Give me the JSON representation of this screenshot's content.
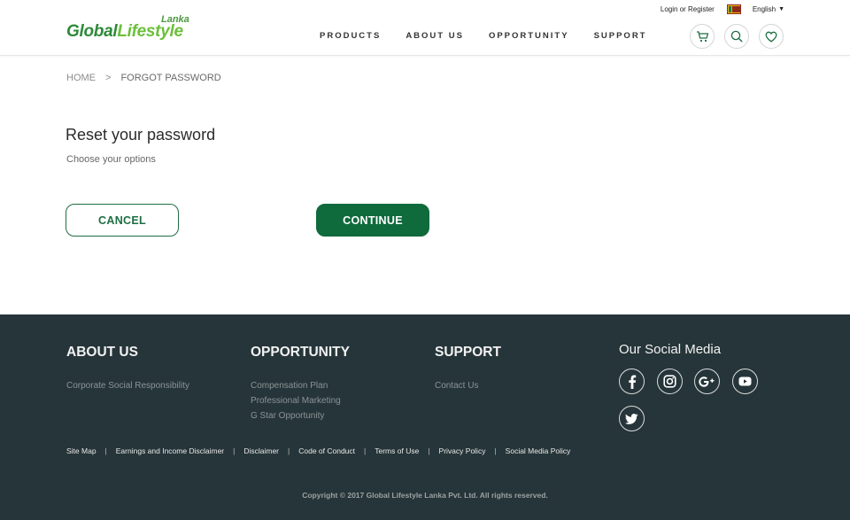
{
  "header": {
    "logo_top": "Lanka",
    "logo_part1": "Global",
    "logo_part2": "Lifestyle",
    "login_register": "Login or Register",
    "language": "English",
    "nav": [
      "PRODUCTS",
      "ABOUT US",
      "OPPORTUNITY",
      "SUPPORT"
    ]
  },
  "breadcrumb": {
    "home": "HOME",
    "separator": ">",
    "current": "FORGOT PASSWORD"
  },
  "main": {
    "title": "Reset your password",
    "subtitle": "Choose your options",
    "cancel_label": "CANCEL",
    "continue_label": "CONTINUE"
  },
  "footer": {
    "about": {
      "heading": "ABOUT US",
      "links": [
        "Corporate Social Responsibility"
      ]
    },
    "opportunity": {
      "heading": "OPPORTUNITY",
      "links": [
        "Compensation Plan",
        "Professional Marketing",
        "G Star Opportunity"
      ]
    },
    "support": {
      "heading": "SUPPORT",
      "links": [
        "Contact Us"
      ]
    },
    "social": {
      "heading": "Our Social Media",
      "icons": [
        "facebook-icon",
        "instagram-icon",
        "google-plus-icon",
        "youtube-icon",
        "twitter-icon"
      ]
    },
    "bottom_links": [
      "Site Map",
      "Earnings and Income Disclaimer",
      "Disclaimer",
      "Code of Conduct",
      "Terms of Use",
      "Privacy Policy",
      "Social Media Policy"
    ],
    "copyright": "Copyright © 2017 Global Lifestyle Lanka Pvt. Ltd. All rights reserved."
  },
  "colors": {
    "brand_green": "#0f6a3c",
    "footer_bg": "#263539",
    "logo_light_green": "#6bbf3a"
  }
}
